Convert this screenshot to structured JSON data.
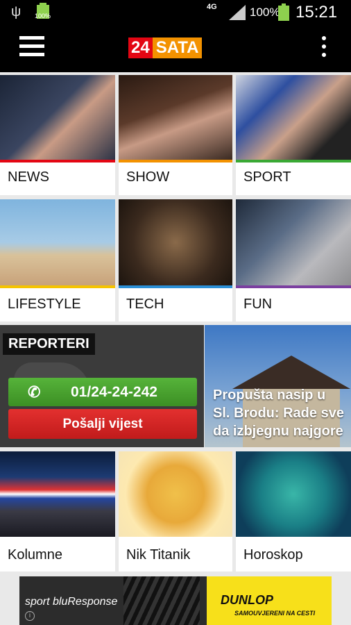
{
  "status_bar": {
    "battery_small": "100%",
    "network": "4G",
    "battery_percent": "100%",
    "time": "15:21"
  },
  "header": {
    "logo_number": "24",
    "logo_text": "SATA"
  },
  "tiles_row1": [
    {
      "label": "NEWS",
      "color": "#e30613"
    },
    {
      "label": "SHOW",
      "color": "#f39200"
    },
    {
      "label": "SPORT",
      "color": "#3aa935"
    }
  ],
  "tiles_row2": [
    {
      "label": "LIFESTYLE",
      "color": "#f5c400"
    },
    {
      "label": "TECH",
      "color": "#2b8fd6"
    },
    {
      "label": "FUN",
      "color": "#7b3fa0"
    }
  ],
  "reporter": {
    "title": "REPORTERI",
    "phone": "01/24-24-242",
    "send_label": "Pošalji vijest"
  },
  "featured_news": {
    "headline": "Propušta nasip u Sl. Brodu: Rade sve da izbjegnu najgore"
  },
  "tiles_row3": [
    {
      "label": "Kolumne"
    },
    {
      "label": "Nik Titanik"
    },
    {
      "label": "Horoskop"
    }
  ],
  "ad": {
    "brand": "sport bluResponse",
    "advertiser": "DUNLOP",
    "slogan": "SAMOUVJERENI NA CESTI",
    "info": "i"
  }
}
